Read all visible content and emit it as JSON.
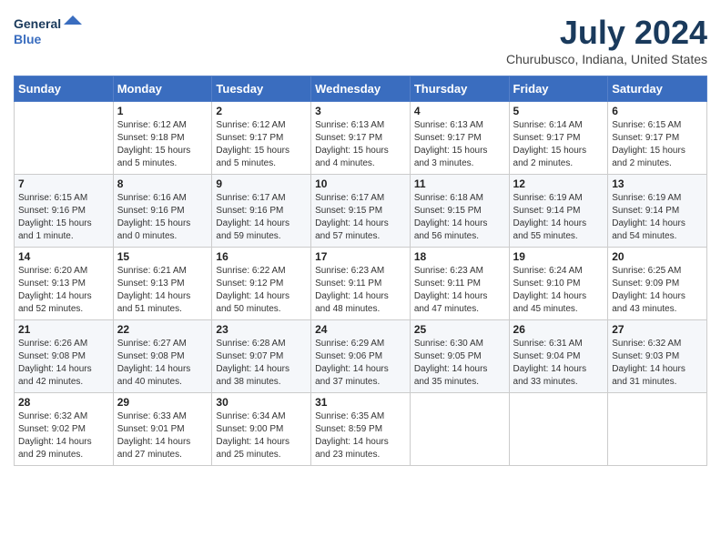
{
  "logo": {
    "line1": "General",
    "line2": "Blue"
  },
  "title": "July 2024",
  "location": "Churubusco, Indiana, United States",
  "days_of_week": [
    "Sunday",
    "Monday",
    "Tuesday",
    "Wednesday",
    "Thursday",
    "Friday",
    "Saturday"
  ],
  "weeks": [
    [
      {
        "day": "",
        "info": ""
      },
      {
        "day": "1",
        "info": "Sunrise: 6:12 AM\nSunset: 9:18 PM\nDaylight: 15 hours\nand 5 minutes."
      },
      {
        "day": "2",
        "info": "Sunrise: 6:12 AM\nSunset: 9:17 PM\nDaylight: 15 hours\nand 5 minutes."
      },
      {
        "day": "3",
        "info": "Sunrise: 6:13 AM\nSunset: 9:17 PM\nDaylight: 15 hours\nand 4 minutes."
      },
      {
        "day": "4",
        "info": "Sunrise: 6:13 AM\nSunset: 9:17 PM\nDaylight: 15 hours\nand 3 minutes."
      },
      {
        "day": "5",
        "info": "Sunrise: 6:14 AM\nSunset: 9:17 PM\nDaylight: 15 hours\nand 2 minutes."
      },
      {
        "day": "6",
        "info": "Sunrise: 6:15 AM\nSunset: 9:17 PM\nDaylight: 15 hours\nand 2 minutes."
      }
    ],
    [
      {
        "day": "7",
        "info": "Sunrise: 6:15 AM\nSunset: 9:16 PM\nDaylight: 15 hours\nand 1 minute."
      },
      {
        "day": "8",
        "info": "Sunrise: 6:16 AM\nSunset: 9:16 PM\nDaylight: 15 hours\nand 0 minutes."
      },
      {
        "day": "9",
        "info": "Sunrise: 6:17 AM\nSunset: 9:16 PM\nDaylight: 14 hours\nand 59 minutes."
      },
      {
        "day": "10",
        "info": "Sunrise: 6:17 AM\nSunset: 9:15 PM\nDaylight: 14 hours\nand 57 minutes."
      },
      {
        "day": "11",
        "info": "Sunrise: 6:18 AM\nSunset: 9:15 PM\nDaylight: 14 hours\nand 56 minutes."
      },
      {
        "day": "12",
        "info": "Sunrise: 6:19 AM\nSunset: 9:14 PM\nDaylight: 14 hours\nand 55 minutes."
      },
      {
        "day": "13",
        "info": "Sunrise: 6:19 AM\nSunset: 9:14 PM\nDaylight: 14 hours\nand 54 minutes."
      }
    ],
    [
      {
        "day": "14",
        "info": "Sunrise: 6:20 AM\nSunset: 9:13 PM\nDaylight: 14 hours\nand 52 minutes."
      },
      {
        "day": "15",
        "info": "Sunrise: 6:21 AM\nSunset: 9:13 PM\nDaylight: 14 hours\nand 51 minutes."
      },
      {
        "day": "16",
        "info": "Sunrise: 6:22 AM\nSunset: 9:12 PM\nDaylight: 14 hours\nand 50 minutes."
      },
      {
        "day": "17",
        "info": "Sunrise: 6:23 AM\nSunset: 9:11 PM\nDaylight: 14 hours\nand 48 minutes."
      },
      {
        "day": "18",
        "info": "Sunrise: 6:23 AM\nSunset: 9:11 PM\nDaylight: 14 hours\nand 47 minutes."
      },
      {
        "day": "19",
        "info": "Sunrise: 6:24 AM\nSunset: 9:10 PM\nDaylight: 14 hours\nand 45 minutes."
      },
      {
        "day": "20",
        "info": "Sunrise: 6:25 AM\nSunset: 9:09 PM\nDaylight: 14 hours\nand 43 minutes."
      }
    ],
    [
      {
        "day": "21",
        "info": "Sunrise: 6:26 AM\nSunset: 9:08 PM\nDaylight: 14 hours\nand 42 minutes."
      },
      {
        "day": "22",
        "info": "Sunrise: 6:27 AM\nSunset: 9:08 PM\nDaylight: 14 hours\nand 40 minutes."
      },
      {
        "day": "23",
        "info": "Sunrise: 6:28 AM\nSunset: 9:07 PM\nDaylight: 14 hours\nand 38 minutes."
      },
      {
        "day": "24",
        "info": "Sunrise: 6:29 AM\nSunset: 9:06 PM\nDaylight: 14 hours\nand 37 minutes."
      },
      {
        "day": "25",
        "info": "Sunrise: 6:30 AM\nSunset: 9:05 PM\nDaylight: 14 hours\nand 35 minutes."
      },
      {
        "day": "26",
        "info": "Sunrise: 6:31 AM\nSunset: 9:04 PM\nDaylight: 14 hours\nand 33 minutes."
      },
      {
        "day": "27",
        "info": "Sunrise: 6:32 AM\nSunset: 9:03 PM\nDaylight: 14 hours\nand 31 minutes."
      }
    ],
    [
      {
        "day": "28",
        "info": "Sunrise: 6:32 AM\nSunset: 9:02 PM\nDaylight: 14 hours\nand 29 minutes."
      },
      {
        "day": "29",
        "info": "Sunrise: 6:33 AM\nSunset: 9:01 PM\nDaylight: 14 hours\nand 27 minutes."
      },
      {
        "day": "30",
        "info": "Sunrise: 6:34 AM\nSunset: 9:00 PM\nDaylight: 14 hours\nand 25 minutes."
      },
      {
        "day": "31",
        "info": "Sunrise: 6:35 AM\nSunset: 8:59 PM\nDaylight: 14 hours\nand 23 minutes."
      },
      {
        "day": "",
        "info": ""
      },
      {
        "day": "",
        "info": ""
      },
      {
        "day": "",
        "info": ""
      }
    ]
  ]
}
